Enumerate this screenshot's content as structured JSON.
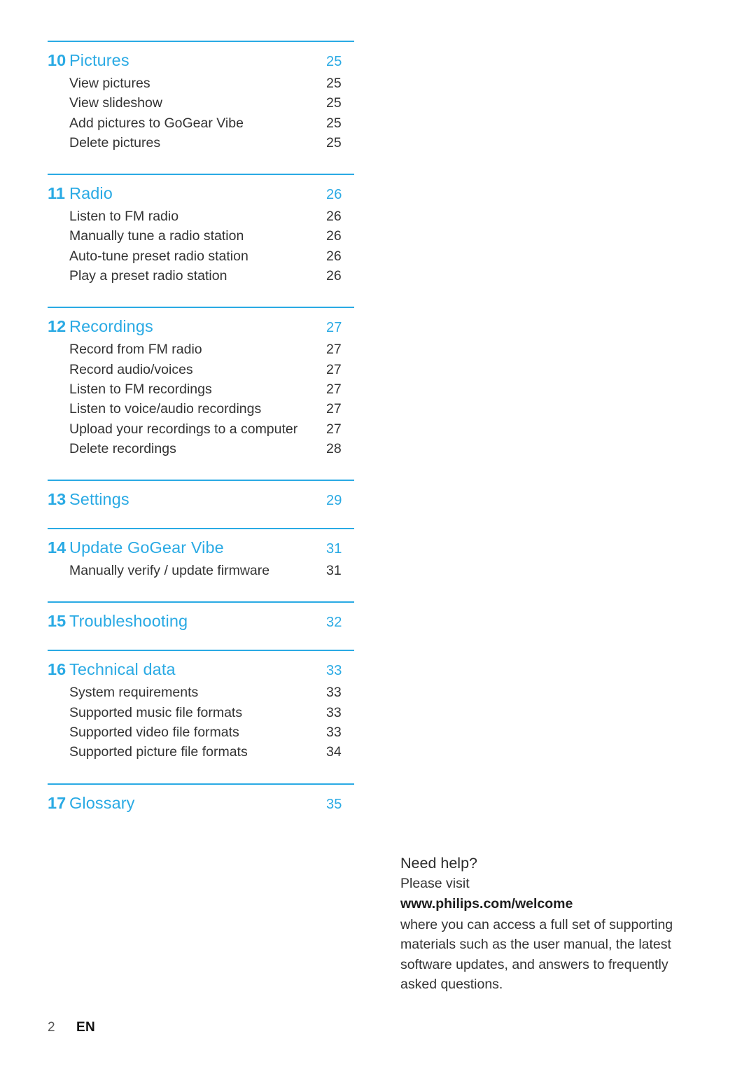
{
  "theme": {
    "accent": "#2aaae4",
    "body_text": "#333333",
    "rule_color": "#2aaae4",
    "background": "#ffffff"
  },
  "toc": {
    "sections": [
      {
        "number": "10",
        "title": "Pictures",
        "page": "25",
        "entries": [
          {
            "title": "View pictures",
            "page": "25"
          },
          {
            "title": "View slideshow",
            "page": "25"
          },
          {
            "title": "Add pictures to GoGear Vibe",
            "page": "25"
          },
          {
            "title": "Delete pictures",
            "page": "25"
          }
        ]
      },
      {
        "number": "11",
        "title": "Radio",
        "page": "26",
        "entries": [
          {
            "title": "Listen to FM radio",
            "page": "26"
          },
          {
            "title": "Manually tune a radio station",
            "page": "26"
          },
          {
            "title": "Auto-tune preset radio station",
            "page": "26"
          },
          {
            "title": "Play a preset radio station",
            "page": "26"
          }
        ]
      },
      {
        "number": "12",
        "title": "Recordings",
        "page": "27",
        "entries": [
          {
            "title": "Record from FM radio",
            "page": "27"
          },
          {
            "title": "Record audio/voices",
            "page": "27"
          },
          {
            "title": "Listen to FM recordings",
            "page": "27"
          },
          {
            "title": "Listen to voice/audio recordings",
            "page": "27"
          },
          {
            "title": "Upload your recordings to a computer",
            "page": "27"
          },
          {
            "title": "Delete recordings",
            "page": "28"
          }
        ]
      },
      {
        "number": "13",
        "title": "Settings",
        "page": "29",
        "entries": []
      },
      {
        "number": "14",
        "title": "Update GoGear Vibe",
        "page": "31",
        "entries": [
          {
            "title": "Manually verify / update firmware",
            "page": "31"
          }
        ]
      },
      {
        "number": "15",
        "title": "Troubleshooting",
        "page": "32",
        "entries": []
      },
      {
        "number": "16",
        "title": "Technical data",
        "page": "33",
        "entries": [
          {
            "title": "System requirements",
            "page": "33"
          },
          {
            "title": "Supported music file formats",
            "page": "33"
          },
          {
            "title": "Supported video file formats",
            "page": "33"
          },
          {
            "title": "Supported picture file formats",
            "page": "34"
          }
        ]
      },
      {
        "number": "17",
        "title": "Glossary",
        "page": "35",
        "entries": []
      }
    ]
  },
  "help": {
    "title": "Need help?",
    "visit_label": "Please visit",
    "url": "www.philips.com/welcome",
    "paragraph": "where you can access a full set of supporting materials such as the user manual, the latest software updates, and answers to frequently asked questions."
  },
  "footer": {
    "page_number": "2",
    "language": "EN"
  }
}
